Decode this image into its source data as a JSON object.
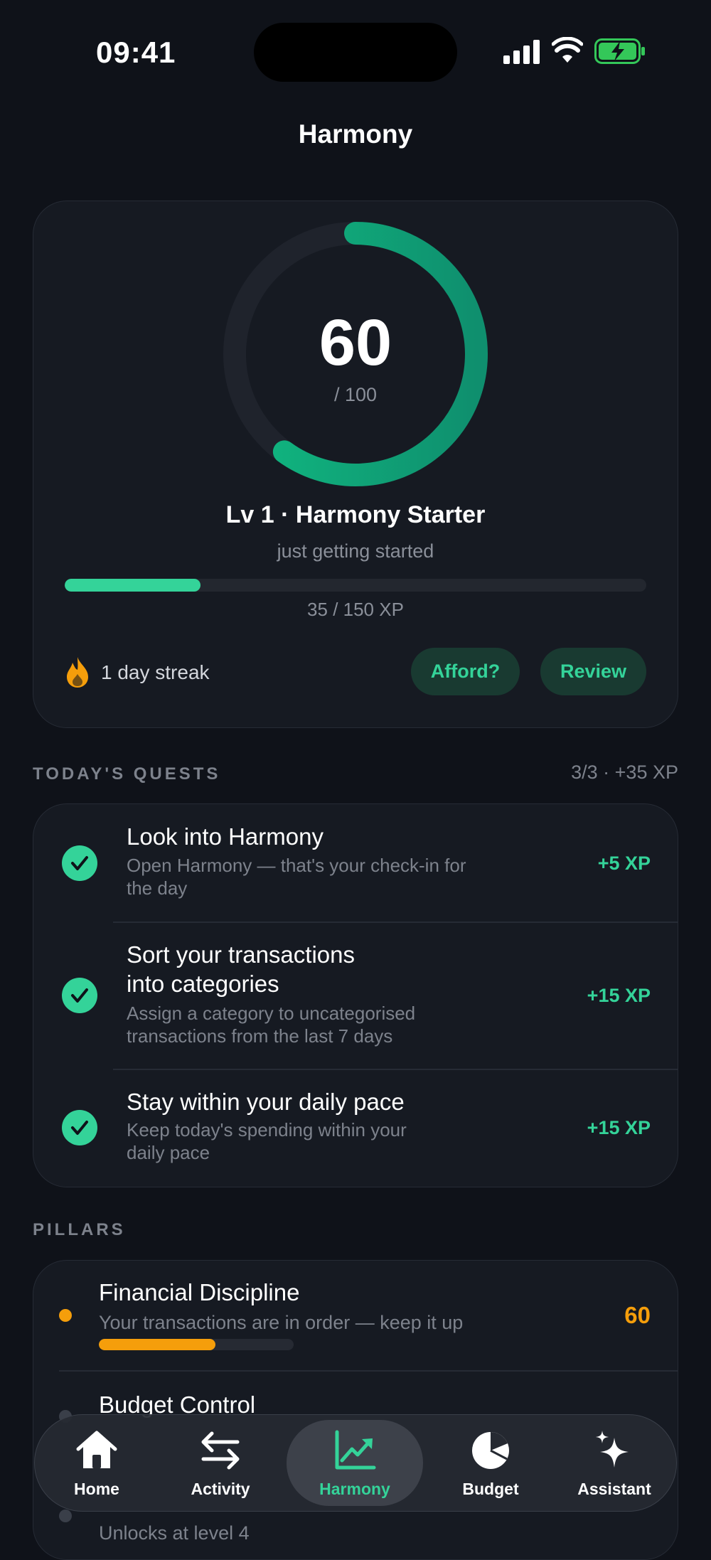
{
  "status_bar": {
    "time": "09:41"
  },
  "header": {
    "title": "Harmony"
  },
  "harmony": {
    "score": "60",
    "score_max": "/ 100",
    "score_fraction": 0.6,
    "level_title": "Lv 1 · Harmony Starter",
    "level_subtitle": "just getting started",
    "xp_fraction": 0.2333,
    "xp_text": "35 / 150 XP",
    "streak_text": "1 day streak",
    "afford_label": "Afford?",
    "review_label": "Review"
  },
  "quests": {
    "section_label": "TODAY'S QUESTS",
    "summary": "3/3 · +35 XP",
    "items": [
      {
        "title": "Look into Harmony",
        "desc_line1": "Open Harmony — that's your check-in for",
        "desc_line2": "the day",
        "xp": "+5 XP"
      },
      {
        "title_line1": "Sort your transactions",
        "title_line2": "into categories",
        "desc_line1": "Assign a category to uncategorised",
        "desc_line2": "transactions from the last 7 days",
        "xp": "+15 XP"
      },
      {
        "title": "Stay within your daily pace",
        "desc_line1": "Keep today's spending within your",
        "desc_line2": "daily pace",
        "xp": "+15 XP"
      }
    ]
  },
  "pillars": {
    "section_label": "PILLARS",
    "items": [
      {
        "title": "Financial Discipline",
        "desc": "Your transactions are in order — keep it up",
        "score": "60",
        "fraction": 0.6
      },
      {
        "title": "Budget Control"
      },
      {
        "desc": "Unlocks at level 4"
      }
    ]
  },
  "tabs": [
    {
      "label": "Home",
      "icon": "home-icon"
    },
    {
      "label": "Activity",
      "icon": "arrows-icon"
    },
    {
      "label": "Harmony",
      "icon": "chart-trend-icon"
    },
    {
      "label": "Budget",
      "icon": "pie-icon"
    },
    {
      "label": "Assistant",
      "icon": "sparkles-icon"
    }
  ],
  "colors": {
    "accent_green": "#34d399",
    "accent_orange": "#f59e0b",
    "background": "#0f1219",
    "card": "#161a22"
  }
}
